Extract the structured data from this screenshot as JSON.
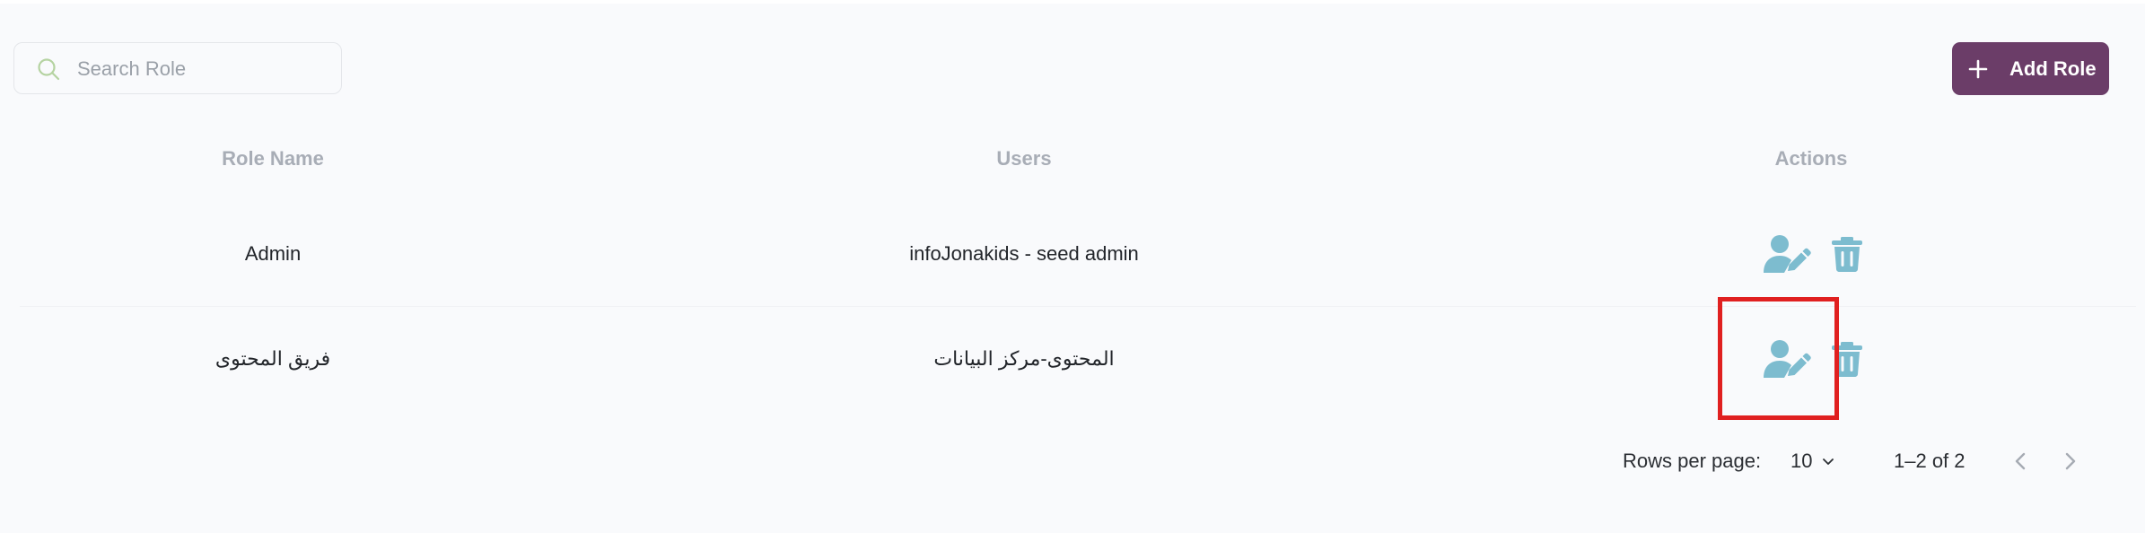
{
  "search": {
    "placeholder": "Search Role",
    "value": ""
  },
  "toolbar": {
    "add_label": "Add Role"
  },
  "table": {
    "headers": [
      "Role Name",
      "Users",
      "Actions"
    ],
    "rows": [
      {
        "role": "Admin",
        "users": "infoJonakids - seed admin"
      },
      {
        "role": "فريق المحتوى",
        "users": "المحتوى-مركز البيانات"
      }
    ]
  },
  "pagination": {
    "rows_per_page_label": "Rows per page:",
    "rows_per_page_value": "10",
    "range_text": "1–2 of 2"
  },
  "icons": {
    "search": "search-icon",
    "add": "plus-icon",
    "edit": "user-edit-icon",
    "delete": "trash-icon",
    "dropdown": "chevron-down-icon",
    "prev": "chevron-left-icon",
    "next": "chevron-right-icon"
  },
  "colors": {
    "accent": "#6b3d68",
    "action_icon": "#7dbccf",
    "highlight": "#e02020"
  }
}
